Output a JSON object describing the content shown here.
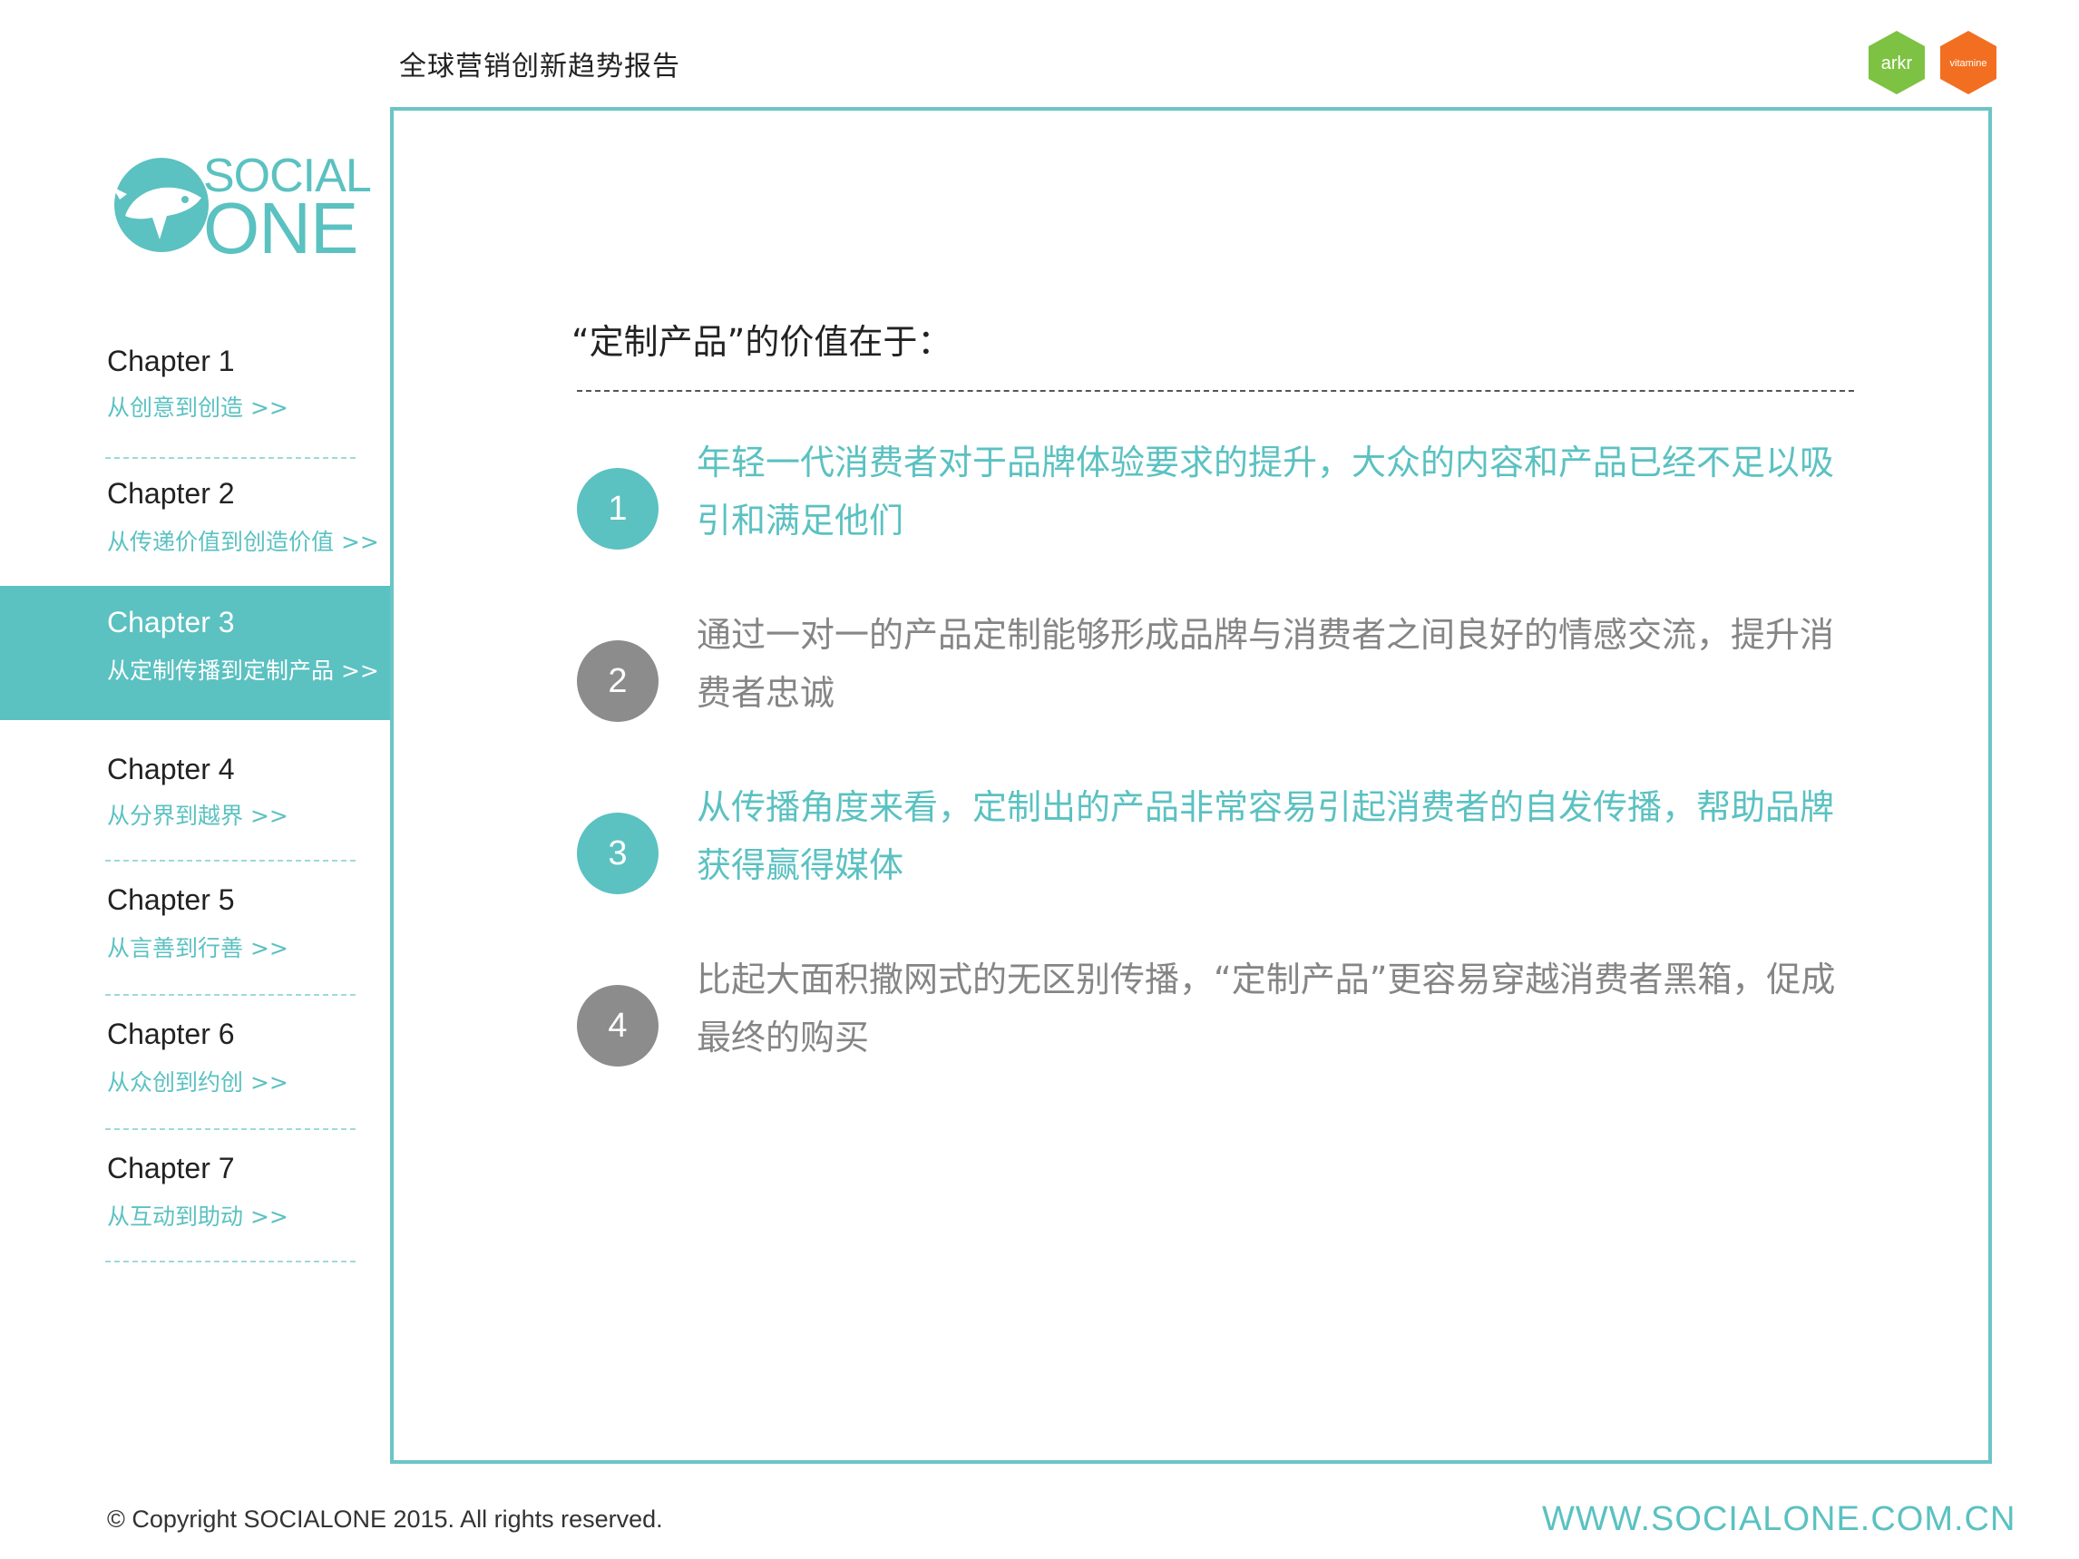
{
  "header": {
    "report_title": "全球营销创新趋势报告",
    "partner_logos": [
      {
        "text": "arkr",
        "color": "#7dc242",
        "icon": "arkr-hexagon-logo"
      },
      {
        "text": "vitamine",
        "color": "#f26f21",
        "icon": "vitamine-hexagon-logo"
      }
    ]
  },
  "brand": {
    "line1": "SOCIAL",
    "line2": "ONE",
    "color": "#5bc1c1",
    "icon": "whale-logo-icon"
  },
  "nav": {
    "active_index": 2,
    "chapters": [
      {
        "title": "Chapter 1",
        "subtitle": "从创意到创造 >>"
      },
      {
        "title": "Chapter 2",
        "subtitle": "从传递价值到创造价值 >>"
      },
      {
        "title": "Chapter 3",
        "subtitle": "从定制传播到定制产品 >>"
      },
      {
        "title": "Chapter 4",
        "subtitle": "从分界到越界 >>"
      },
      {
        "title": "Chapter 5",
        "subtitle": "从言善到行善 >>"
      },
      {
        "title": "Chapter 6",
        "subtitle": "从众创到约创 >>"
      },
      {
        "title": "Chapter 7",
        "subtitle": "从互动到助动 >>"
      }
    ]
  },
  "main": {
    "heading": "“定制产品”的价值在于：",
    "points": [
      {
        "number": "1",
        "text": "年轻一代消费者对于品牌体验要求的提升，大众的内容和产品已经不足以吸引和满足他们",
        "style": "teal"
      },
      {
        "number": "2",
        "text": "通过一对一的产品定制能够形成品牌与消费者之间良好的情感交流，提升消费者忠诚",
        "style": "gray"
      },
      {
        "number": "3",
        "text": "从传播角度来看，定制出的产品非常容易引起消费者的自发传播，帮助品牌获得赢得媒体",
        "style": "teal"
      },
      {
        "number": "4",
        "text": "比起大面积撒网式的无区别传播，“定制产品”更容易穿越消费者黑箱，促成最终的购买",
        "style": "gray"
      }
    ]
  },
  "footer": {
    "copyright": "© Copyright SOCIALONE 2015. All rights reserved.",
    "website": "WWW.SOCIALONE.COM.CN"
  },
  "colors": {
    "accent": "#5bc1c1",
    "gray": "#8c8c8c"
  }
}
